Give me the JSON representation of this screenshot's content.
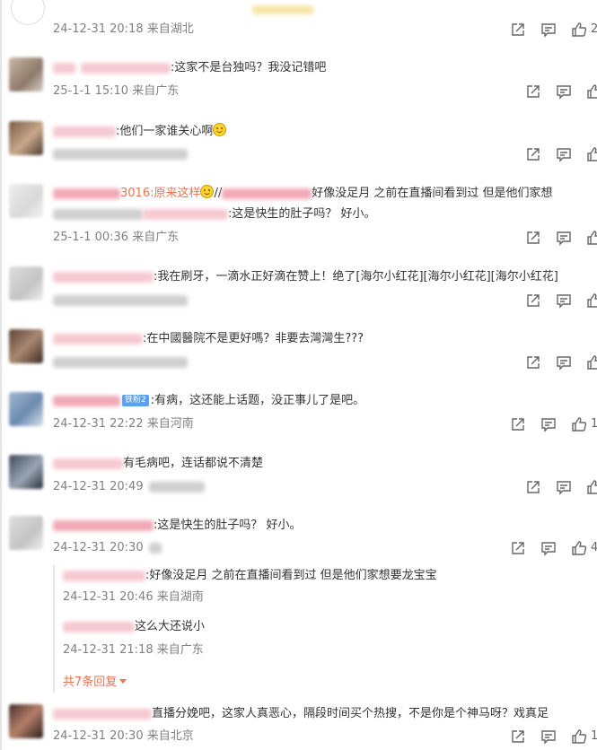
{
  "top": {
    "meta": "24-12-31 20:18 来自湖北",
    "like_count": "2"
  },
  "comments": [
    {
      "text": ":这家不是台独吗？我没记错吧",
      "meta": "25-1-1 15:10 来自广东"
    },
    {
      "text": ":他们一家谁关心啊"
    },
    {
      "text_a": "3016:原来这样",
      "text_b": "//",
      "text_c": "好像没足月 之前在直播间看到过 但是他们家想",
      "text_d": ":这是快生的肚子吗？ 好小。",
      "meta": "25-1-1 00:36 来自广东"
    },
    {
      "text": ":我在刷牙，一滴水正好滴在赞上！绝了[海尔小红花][海尔小红花][海尔小红花]"
    },
    {
      "text": ":在中國醫院不是更好嗎？非要去灣灣生???"
    },
    {
      "badge": "铁粉2",
      "text": ":有病，这还能上话题，没正事儿了是吧。",
      "meta": "24-12-31 22:22 来自河南",
      "like_count": "1"
    },
    {
      "text": "有毛病吧，连话都说不清楚",
      "meta": "24-12-31 20:49"
    },
    {
      "text": ":这是快生的肚子吗？ 好小。",
      "meta": "24-12-31 20:30",
      "like_count": "4"
    },
    {
      "text": "直播分娩吧，这家人真恶心，隔段时间买个热搜，不是你是个神马呀？戏真足",
      "meta": "24-12-31 20:30 来自北京",
      "like_count": "1"
    }
  ],
  "replies": [
    {
      "text": ":好像没足月 之前在直播间看到过 但是他们家想要龙宝宝",
      "meta": "24-12-31 20:46 来自湖南"
    },
    {
      "text": "这么大还说小",
      "meta": "24-12-31 21:18 来自广东"
    }
  ],
  "more_replies": "共7条回复",
  "colors": {
    "meta": "#808080",
    "link": "#eb7350",
    "badge": "#5ba0ec"
  }
}
